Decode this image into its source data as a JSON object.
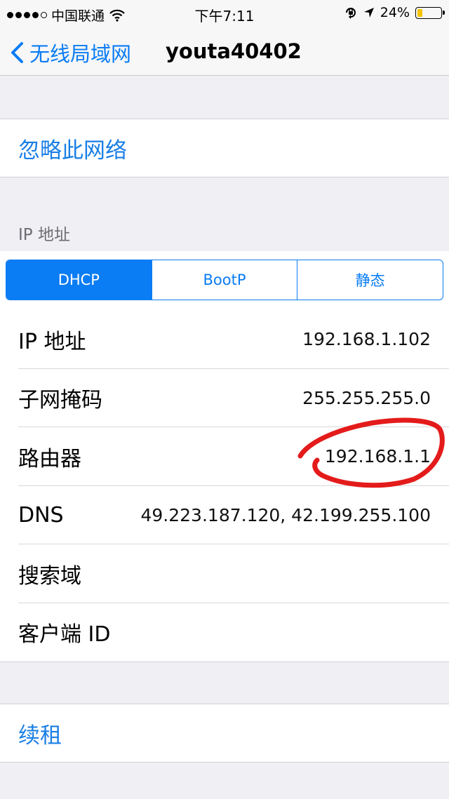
{
  "status_bar": {
    "carrier": "中国联通",
    "time": "下午7:11",
    "battery_percent": "24%",
    "battery_level": 0.24
  },
  "nav": {
    "back_label": "无线局域网",
    "title": "youta40402"
  },
  "forget_network": "忽略此网络",
  "ip_section": {
    "header": "IP 地址",
    "segments": [
      "DHCP",
      "BootP",
      "静态"
    ],
    "selected_segment": "DHCP"
  },
  "rows": [
    {
      "label": "IP 地址",
      "value": "192.168.1.102"
    },
    {
      "label": "子网掩码",
      "value": "255.255.255.0"
    },
    {
      "label": "路由器",
      "value": "192.168.1.1"
    },
    {
      "label": "DNS",
      "value": "49.223.187.120, 42.199.255.100"
    },
    {
      "label": "搜索域",
      "value": ""
    },
    {
      "label": "客户端 ID",
      "value": ""
    }
  ],
  "renew_lease": "续租",
  "colors": {
    "accent": "#0a7cf4",
    "annotation": "#e41b1b",
    "battery": "#f5c400"
  },
  "icons": [
    "chevron-left-icon",
    "wifi-icon",
    "orientation-lock-icon",
    "location-arrow-icon",
    "battery-icon"
  ]
}
